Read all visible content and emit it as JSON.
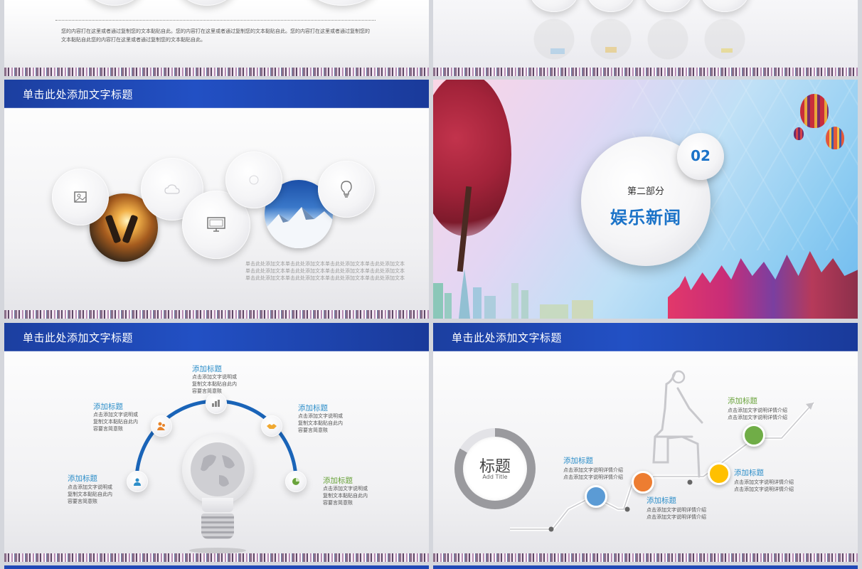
{
  "slides": {
    "s1": {
      "body_text": "您的内容打在这里或者通过复制您的文本黏贴自此。您的内容打在这里或者通过复制您的文本黏贴自此。您的内容打在这里或者通过复制您的文本黏贴自此您的内容打在这里或者通过复制您的文本黏贴自此。"
    },
    "s3": {
      "header": "单击此处添加文字标题",
      "body_lines": [
        "单击此处添加文本单击此处添加文本单击此处添加文本单击此处添加文本",
        "单击此处添加文本单击此处添加文本单击此处添加文本单击此处添加文本",
        "单击此处添加文本单击此处添加文本单击此处添加文本单击此处添加文本"
      ]
    },
    "s4": {
      "number": "02",
      "subtitle": "第二部分",
      "title": "娱乐新闻"
    },
    "s5": {
      "header": "单击此处添加文字标题",
      "items": [
        {
          "title": "添加标题",
          "lines": [
            "点击添加文字说明或",
            "复制文本黏贴自此内",
            "容要言简意赅"
          ]
        },
        {
          "title": "添加标题",
          "lines": [
            "点击添加文字说明或",
            "复制文本黏贴自此内",
            "容要言简意赅"
          ]
        },
        {
          "title": "添加标题",
          "lines": [
            "点击添加文字说明或",
            "复制文本黏贴自此内",
            "容要言简意赅"
          ]
        },
        {
          "title": "添加标题",
          "lines": [
            "点击添加文字说明或",
            "复制文本黏贴自此内",
            "容要言简意赅"
          ]
        },
        {
          "title": "添加标题",
          "lines": [
            "点击添加文字说明或",
            "复制文本黏贴自此内",
            "容要言简意赅"
          ]
        }
      ]
    },
    "s6": {
      "header": "单击此处添加文字标题",
      "center_title": "标题",
      "center_sub": "Add Title",
      "items": [
        {
          "title": "添加标题",
          "lines": [
            "点击添加文字说明详情介绍",
            "点击添加文字说明详情介绍"
          ],
          "color": "#5b9bd5"
        },
        {
          "title": "添加标题",
          "lines": [
            "点击添加文字说明详情介绍",
            "点击添加文字说明详情介绍"
          ],
          "color": "#ed7d31"
        },
        {
          "title": "添加标题",
          "lines": [
            "点击添加文字说明详情介绍",
            "点击添加文字说明详情介绍"
          ],
          "color": "#ffc000"
        },
        {
          "title": "添加标题",
          "lines": [
            "点击添加文字说明详情介绍",
            "点击添加文字说明详情介绍"
          ],
          "color": "#70ad47"
        }
      ]
    }
  },
  "colors": {
    "header_blue": "#1f48b6",
    "accent_blue": "#1b73c8",
    "title_teal": "#2d8ec9"
  }
}
